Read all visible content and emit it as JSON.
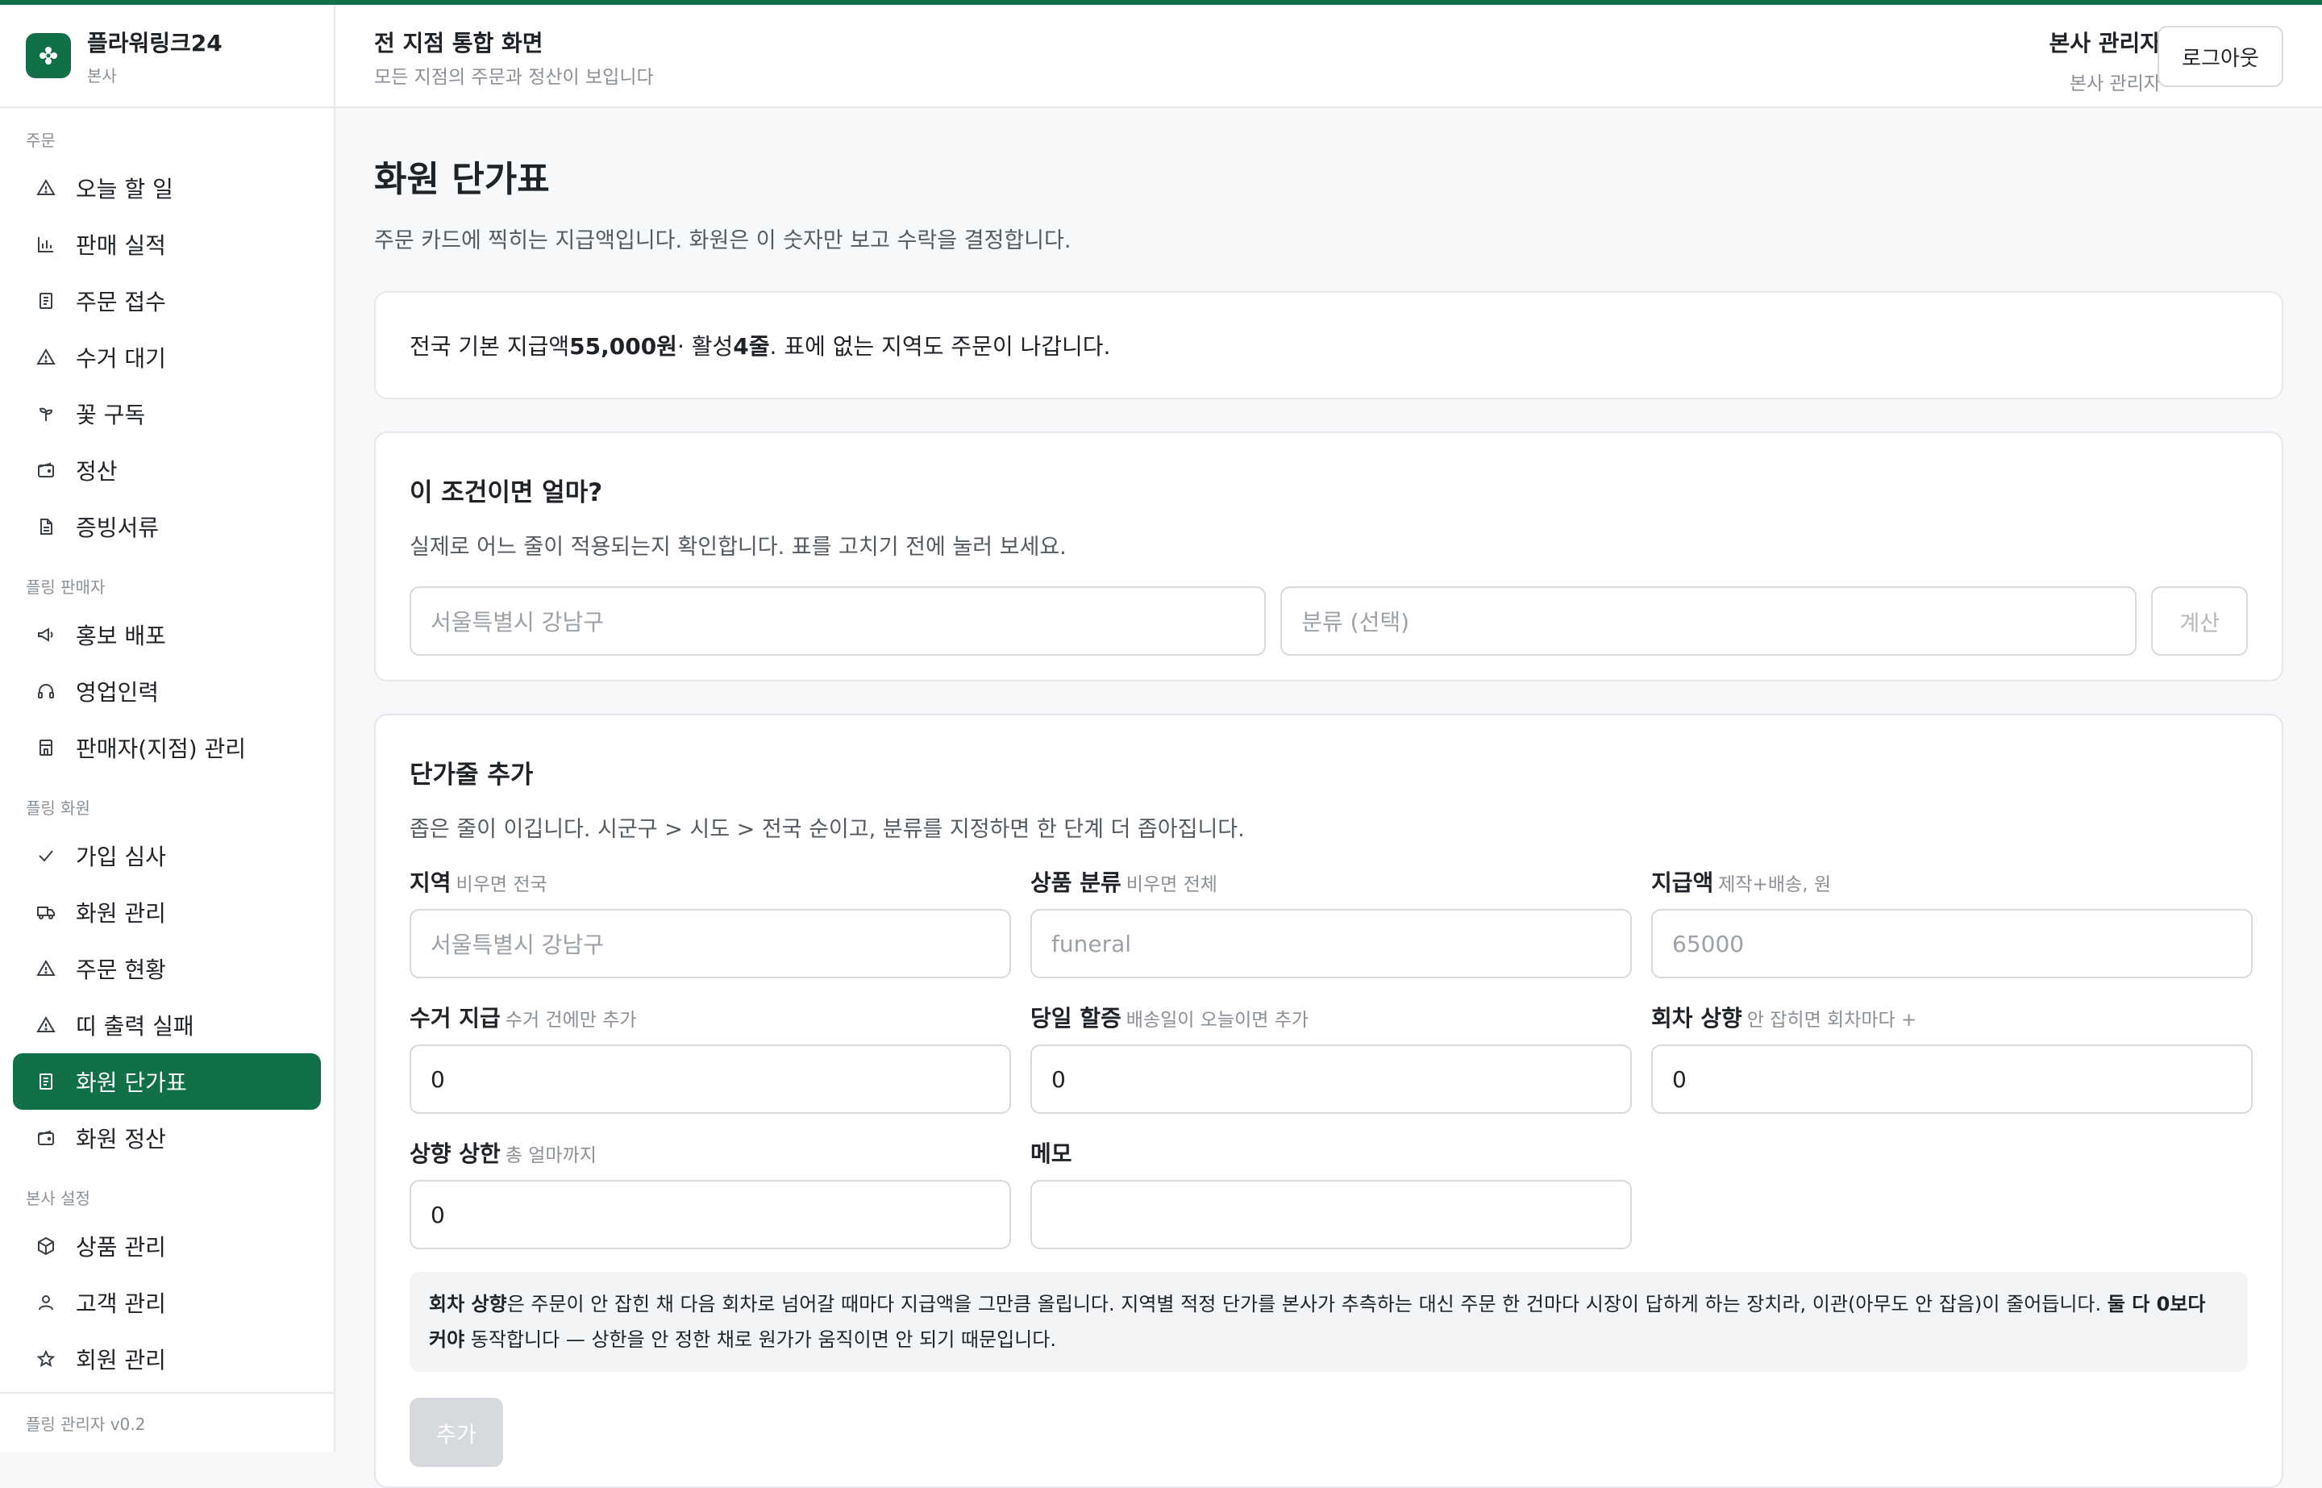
{
  "brand": {
    "name": "플라워링크24",
    "sub": "본사"
  },
  "header": {
    "title": "전 지점 통합 화면",
    "subtitle": "모든 지점의 주문과 정산이 보입니다",
    "user_name": "본사 관리자",
    "user_role": "본사 관리자",
    "logout": "로그아웃"
  },
  "sidebar": {
    "sections": [
      {
        "label": "주문",
        "items": [
          {
            "label": "오늘 할 일",
            "icon": "warning-icon"
          },
          {
            "label": "판매 실적",
            "icon": "bar-chart-icon"
          },
          {
            "label": "주문 접수",
            "icon": "receipt-icon"
          },
          {
            "label": "수거 대기",
            "icon": "warning-icon"
          },
          {
            "label": "꽃 구독",
            "icon": "sprout-icon"
          },
          {
            "label": "정산",
            "icon": "wallet-icon"
          },
          {
            "label": "증빙서류",
            "icon": "document-icon"
          }
        ]
      },
      {
        "label": "플링 판매자",
        "items": [
          {
            "label": "홍보 배포",
            "icon": "megaphone-icon"
          },
          {
            "label": "영업인력",
            "icon": "headset-icon"
          },
          {
            "label": "판매자(지점) 관리",
            "icon": "store-icon"
          }
        ]
      },
      {
        "label": "플링 화원",
        "items": [
          {
            "label": "가입 심사",
            "icon": "check-icon"
          },
          {
            "label": "화원 관리",
            "icon": "truck-icon"
          },
          {
            "label": "주문 현황",
            "icon": "warning-icon"
          },
          {
            "label": "띠 출력 실패",
            "icon": "warning-icon"
          },
          {
            "label": "화원 단가표",
            "icon": "receipt-icon",
            "active": true
          },
          {
            "label": "화원 정산",
            "icon": "wallet-icon"
          }
        ]
      },
      {
        "label": "본사 설정",
        "items": [
          {
            "label": "상품 관리",
            "icon": "box-icon"
          },
          {
            "label": "고객 관리",
            "icon": "user-icon"
          },
          {
            "label": "회원 관리",
            "icon": "star-icon"
          }
        ]
      }
    ],
    "footer": "플링 관리자 v0.2"
  },
  "page": {
    "title": "화원 단가표",
    "description": "주문 카드에 찍히는 지급액입니다. 화원은 이 숫자만 보고 수락을 결정합니다."
  },
  "summary": {
    "prefix": "전국 기본 지급액 ",
    "amount": "55,000원",
    "middle": " · 활성 ",
    "count": "4줄",
    "suffix": ". 표에 없는 지역도 주문이 나갑니다."
  },
  "calculator": {
    "title": "이 조건이면 얼마?",
    "description": "실제로 어느 줄이 적용되는지 확인합니다. 표를 고치기 전에 눌러 보세요.",
    "region_placeholder": "서울특별시 강남구",
    "category_placeholder": "분류 (선택)",
    "button": "계산"
  },
  "add_row": {
    "title": "단가줄 추가",
    "description": "좁은 줄이 이깁니다. 시군구 > 시도 > 전국 순이고, 분류를 지정하면 한 단계 더 좁아집니다.",
    "fields": [
      {
        "label": "지역",
        "hint": "비우면 전국",
        "placeholder": "서울특별시 강남구",
        "value": ""
      },
      {
        "label": "상품 분류",
        "hint": "비우면 전체",
        "placeholder": "funeral",
        "value": ""
      },
      {
        "label": "지급액",
        "hint": "제작+배송, 원",
        "placeholder": "65000",
        "value": ""
      },
      {
        "label": "수거 지급",
        "hint": "수거 건에만 추가",
        "placeholder": "",
        "value": "0"
      },
      {
        "label": "당일 할증",
        "hint": "배송일이 오늘이면 추가",
        "placeholder": "",
        "value": "0"
      },
      {
        "label": "회차 상향",
        "hint": "안 잡히면 회차마다 +",
        "placeholder": "",
        "value": "0"
      },
      {
        "label": "상향 상한",
        "hint": "총 얼마까지",
        "placeholder": "",
        "value": "0"
      },
      {
        "label": "메모",
        "hint": "",
        "placeholder": "",
        "value": ""
      }
    ],
    "note": {
      "b1": "회차 상향",
      "t1": "은 주문이 안 잡힌 채 다음 회차로 넘어갈 때마다 지급액을 그만큼 올립니다. 지역별 적정 단가를 본사가 추측하는 대신 주문 한 건마다 시장이 답하게 하는 장치라, 이관(아무도 안 잡음)이 줄어듭니다. ",
      "b2": "둘 다 0보다 커야",
      "t2": " 동작합니다 — 상한을 안 정한 채로 원가가 움직이면 안 되기 때문입니다."
    },
    "button": "추가"
  },
  "colors": {
    "accent": "#127048"
  }
}
